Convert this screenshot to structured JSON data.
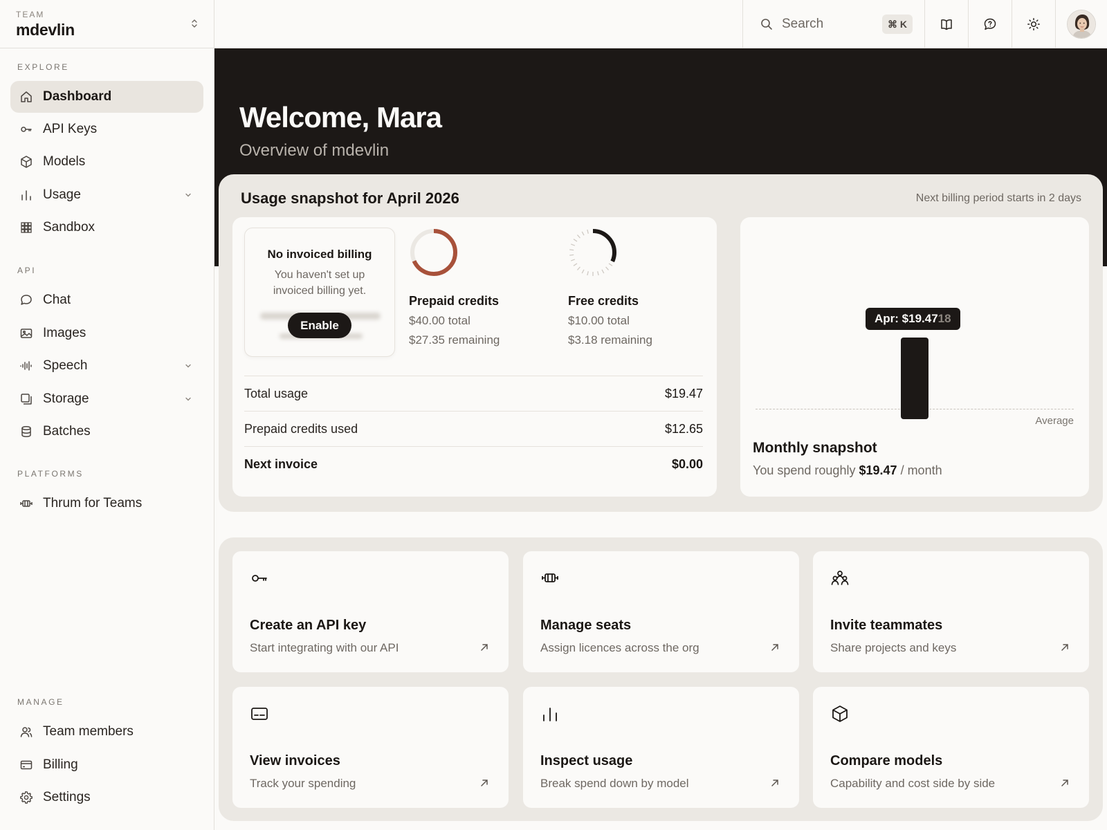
{
  "team": {
    "kicker": "TEAM",
    "name": "mdevlin"
  },
  "sidebar": {
    "sections": {
      "explore": "EXPLORE",
      "api": "API",
      "platforms": "PLATFORMS",
      "manage": "MANAGE"
    },
    "items": {
      "dashboard": "Dashboard",
      "api_keys": "API Keys",
      "models": "Models",
      "usage": "Usage",
      "sandbox": "Sandbox",
      "chat": "Chat",
      "images": "Images",
      "speech": "Speech",
      "storage": "Storage",
      "batches": "Batches",
      "thrum_for_teams": "Thrum for Teams",
      "team_members": "Team members",
      "billing": "Billing",
      "settings": "Settings"
    },
    "active": "dashboard"
  },
  "topbar": {
    "search_label": "Search",
    "search_shortcut": "⌘ K"
  },
  "hero": {
    "title": "Welcome, Mara",
    "subtitle": "Overview of mdevlin"
  },
  "snapshot": {
    "title": "Usage snapshot for April 2026",
    "note": "Next billing period starts in 2 days",
    "invoiced_billing": {
      "title": "No invoiced billing",
      "text": "You haven't set up invoiced billing yet.",
      "button": "Enable"
    },
    "prepaid": {
      "name": "Prepaid credits",
      "total": "$40.00 total",
      "remaining": "$27.35 remaining",
      "remaining_fraction": 0.684
    },
    "free": {
      "name": "Free credits",
      "total": "$10.00 total",
      "remaining": "$3.18 remaining",
      "remaining_fraction": 0.318
    },
    "rows": {
      "total_usage_label": "Total usage",
      "total_usage_value": "$19.47",
      "prepaid_used_label": "Prepaid credits used",
      "prepaid_used_value": "$12.65",
      "next_invoice_label": "Next invoice",
      "next_invoice_value": "$0.00"
    },
    "monthly": {
      "tooltip_main": "Apr: $19.47",
      "tooltip_dim": "18",
      "avg_label": "Average",
      "title": "Monthly snapshot",
      "sub_prefix": "You spend roughly",
      "sub_amount": "$19.47",
      "sub_suffix": "/ month"
    }
  },
  "actions": [
    {
      "title": "Create an API key",
      "desc": "Start integrating with our API",
      "icon": "key-icon"
    },
    {
      "title": "Manage seats",
      "desc": "Assign licences across the org",
      "icon": "seat-icon"
    },
    {
      "title": "Invite teammates",
      "desc": "Share projects and keys",
      "icon": "people-icon"
    },
    {
      "title": "View invoices",
      "desc": "Track your spending",
      "icon": "invoice-icon"
    },
    {
      "title": "Inspect usage",
      "desc": "Break spend down by model",
      "icon": "bar-chart-icon"
    },
    {
      "title": "Compare models",
      "desc": "Capability and cost side by side",
      "icon": "cube-icon"
    }
  ],
  "colors": {
    "accent_prepaid": "#a8513a",
    "hero_background": "#1c1816",
    "panel": "#ebe8e3"
  }
}
